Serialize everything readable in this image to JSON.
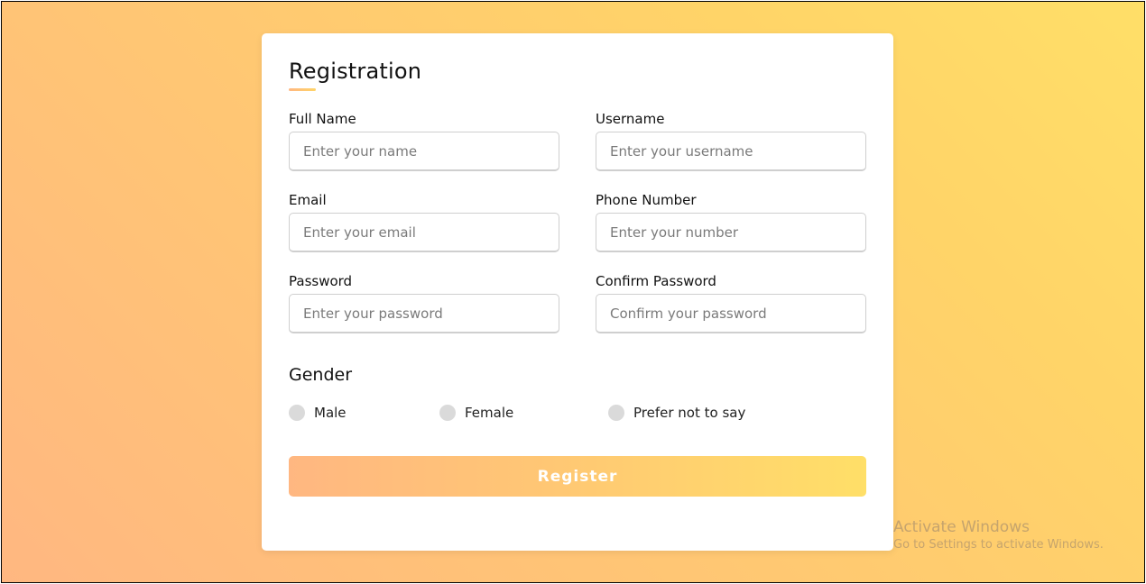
{
  "form": {
    "title": "Registration",
    "fields": [
      {
        "label": "Full Name",
        "placeholder": "Enter your name",
        "value": ""
      },
      {
        "label": "Username",
        "placeholder": "Enter your username",
        "value": ""
      },
      {
        "label": "Email",
        "placeholder": "Enter your email",
        "value": ""
      },
      {
        "label": "Phone Number",
        "placeholder": "Enter your number",
        "value": ""
      },
      {
        "label": "Password",
        "placeholder": "Enter your password",
        "value": ""
      },
      {
        "label": "Confirm Password",
        "placeholder": "Confirm your password",
        "value": ""
      }
    ],
    "gender": {
      "title": "Gender",
      "options": [
        {
          "label": "Male",
          "selected": false
        },
        {
          "label": "Female",
          "selected": false
        },
        {
          "label": "Prefer not to say",
          "selected": false
        }
      ]
    },
    "submit_label": "Register"
  },
  "colors": {
    "gradient_start": "#ffb781",
    "gradient_end": "#ffdf68",
    "radio_unselected": "#dadada"
  },
  "watermark": {
    "title": "Activate Windows",
    "subtitle": "Go to Settings to activate Windows."
  }
}
